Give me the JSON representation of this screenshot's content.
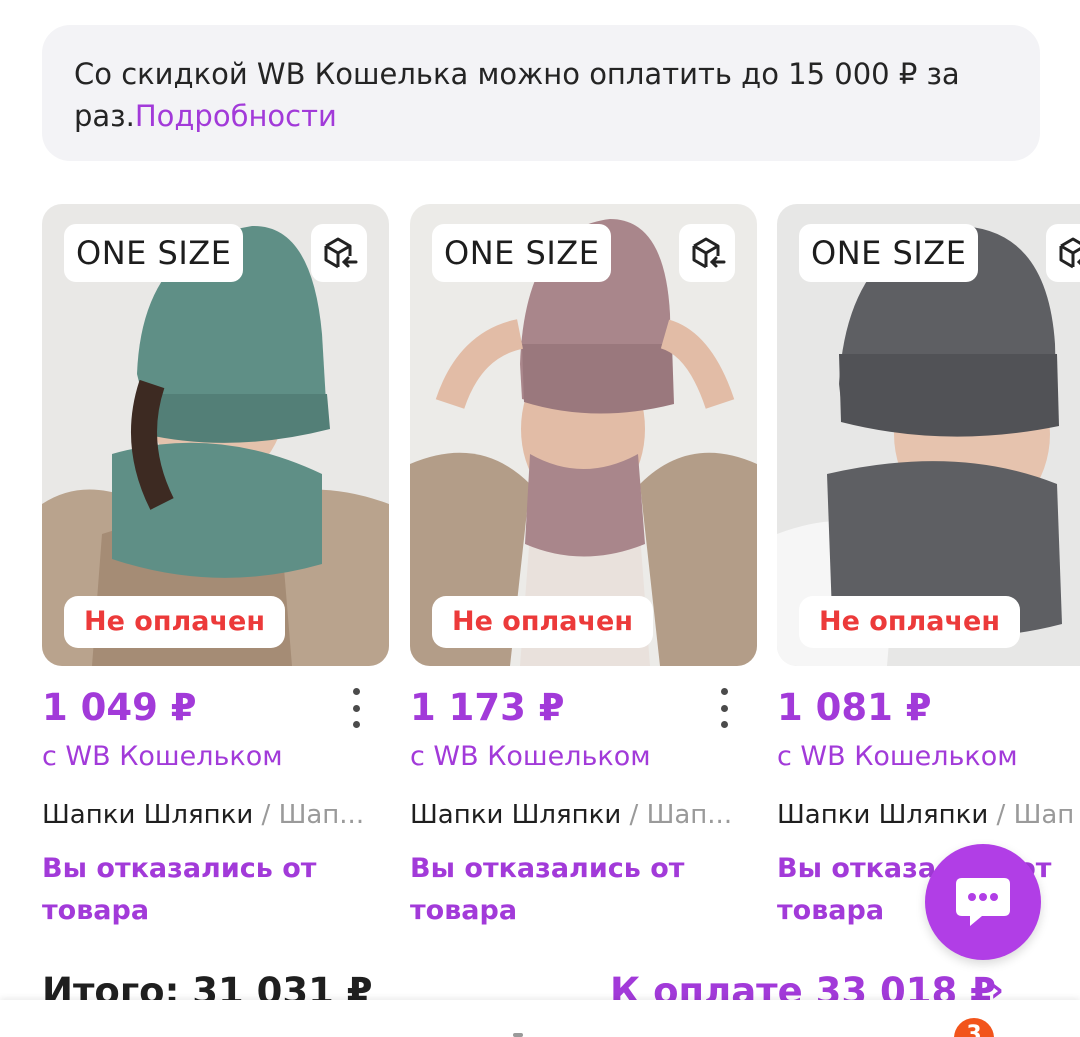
{
  "banner": {
    "text": "Со скидкой WB Кошелька можно оплатить до 15 000 ₽ за раз.",
    "link": "Подробности"
  },
  "products": [
    {
      "size": "ONE SIZE",
      "status": "Не оплачен",
      "price": "1 049 ₽",
      "wallet_note": "с WB Кошельком",
      "brand": "Шапки Шляпки",
      "separator": "/",
      "category": "Шап...",
      "refusal": "Вы отказались от товара",
      "color": "#5f8f86"
    },
    {
      "size": "ONE SIZE",
      "status": "Не оплачен",
      "price": "1 173 ₽",
      "wallet_note": "с WB Кошельком",
      "brand": "Шапки Шляпки",
      "separator": "/",
      "category": "Шап...",
      "refusal": "Вы отказались от товара",
      "color": "#a9868b"
    },
    {
      "size": "ONE SIZE",
      "status": "Не оплачен",
      "price": "1 081 ₽",
      "wallet_note": "с WB Кошельком",
      "brand": "Шапки Шляпки",
      "separator": "/",
      "category": "Шап",
      "refusal": "Вы отказались от товара",
      "color": "#5e5f63"
    }
  ],
  "totals": {
    "total": "Итого: 31 031 ₽",
    "pay": "К оплате 33 018 ₽",
    "arrow": "›"
  },
  "cart_badge": "3",
  "icons": {
    "return": "box-return-icon",
    "kebab": "kebab-menu-icon",
    "chat": "chat-bubble-icon"
  },
  "colors": {
    "accent": "#a23ad9",
    "status_red": "#ec3a3a",
    "banner_bg": "#f3f3f6"
  }
}
